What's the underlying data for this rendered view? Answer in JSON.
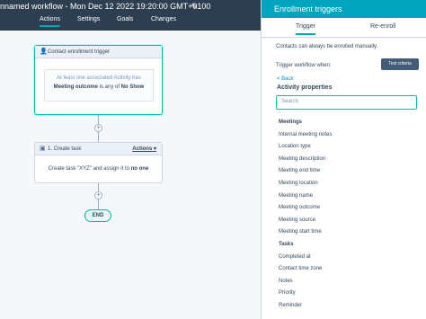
{
  "header": {
    "title": "nnamed workflow - Mon Dec 12 2022 19:20:00 GMT+0100",
    "tabs": [
      "Actions",
      "Settings",
      "Goals",
      "Changes"
    ]
  },
  "trigger_card": {
    "title": "Contact enrollment trigger",
    "line1": "At least one associated Activity has",
    "field": "Meeting outcome",
    "op": " is any of ",
    "value": "No Show"
  },
  "task_card": {
    "title": "1. Create task",
    "actions": "Actions",
    "body_pre": "Create task \"XYZ\" and assign it to ",
    "body_val": "no one"
  },
  "end_label": "END",
  "panel": {
    "title": "Enrollment triggers",
    "tabs": [
      "Trigger",
      "Re-enroll"
    ],
    "info": "Contacts can always be enrolled manually.",
    "trigger_when": "Trigger workflow when:",
    "test_button": "Test criteria",
    "back": "< Back",
    "section": "Activity properties",
    "search_placeholder": "Search",
    "items": [
      {
        "label": "Meetings",
        "group": true
      },
      {
        "label": "Internal meeting notes"
      },
      {
        "label": "Location type"
      },
      {
        "label": "Meeting description"
      },
      {
        "label": "Meeting end time"
      },
      {
        "label": "Meeting location"
      },
      {
        "label": "Meeting name"
      },
      {
        "label": "Meeting outcome"
      },
      {
        "label": "Meeting source"
      },
      {
        "label": "Meeting start time"
      },
      {
        "label": "Tasks",
        "group": true
      },
      {
        "label": "Completed at"
      },
      {
        "label": "Contact time zone"
      },
      {
        "label": "Notes"
      },
      {
        "label": "Priority"
      },
      {
        "label": "Reminder"
      }
    ]
  }
}
